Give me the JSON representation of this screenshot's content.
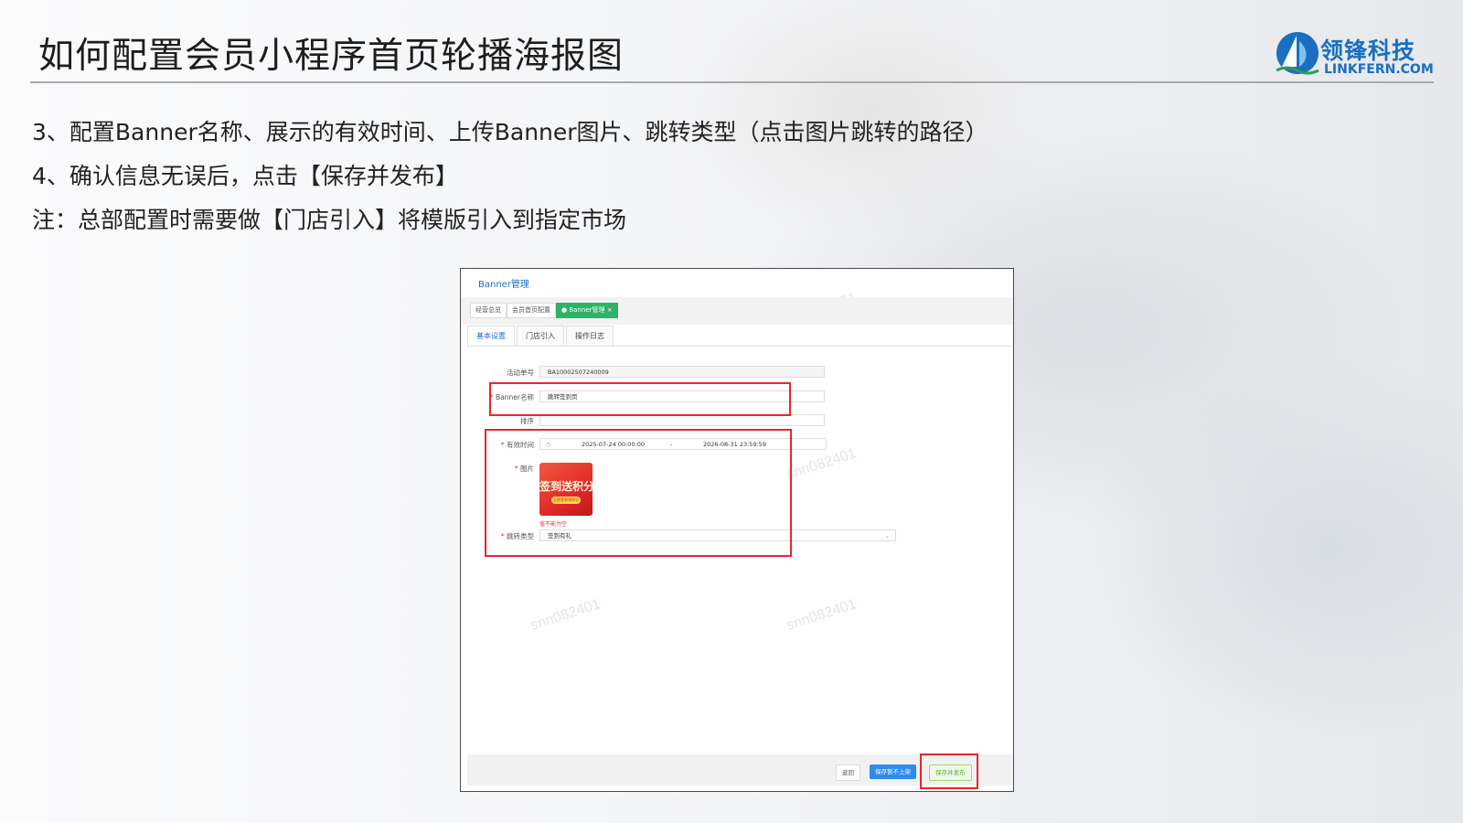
{
  "slide": {
    "title": "如何配置会员小程序首页轮播海报图",
    "logo": {
      "cn": "领锋科技",
      "en": "LINKFERN.COM"
    },
    "steps": [
      "3、配置Banner名称、展示的有效时间、上传Banner图片、跳转类型（点击图片跳转的路径）",
      "4、确认信息无误后，点击【保存并发布】",
      "注：总部配置时需要做【门店引入】将模版引入到指定市场"
    ]
  },
  "screenshot": {
    "page_title": "Banner管理",
    "tags": [
      "经营总览",
      "会员首页配置",
      "● Banner管理 ×"
    ],
    "tabs": [
      "基本设置",
      "门店引入",
      "操作日志"
    ],
    "form": {
      "activity_no_label": "活动单号",
      "activity_no_value": "BA10002507240009",
      "banner_name_label": "Banner名称",
      "banner_name_value": "跳转签到页",
      "sort_label": "排序",
      "valid_time_label": "有效时间",
      "valid_start": "2025-07-24 00:00:00",
      "valid_sep": "-",
      "valid_end": "2026-08-31 23:59:59",
      "image_label": "图片",
      "image_poster_text": "签到送积分",
      "image_poster_sub": "立即签到领积分",
      "image_error": "值不能为空",
      "jump_type_label": "跳转类型",
      "jump_type_value": "签到有礼"
    },
    "buttons": {
      "back": "返回",
      "save_no_publish": "保存暂不上架",
      "save_publish": "保存并发布"
    },
    "watermark": "snn082401"
  },
  "colors": {
    "highlight": "#e8262b",
    "accent_blue": "#1f6ad2",
    "tag_green": "#2eb266",
    "brand_blue": "#1a6fc0"
  }
}
